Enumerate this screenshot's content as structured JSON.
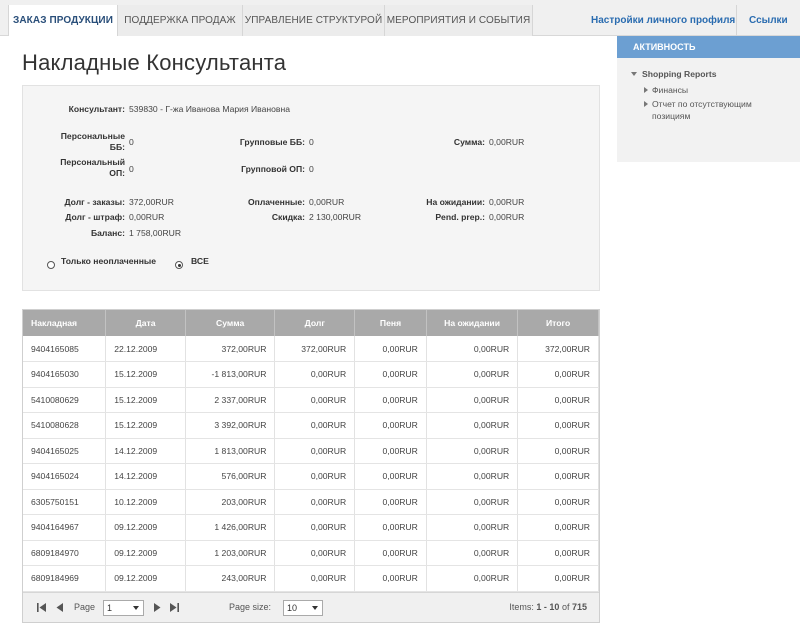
{
  "nav": {
    "tabs": [
      "ЗАКАЗ ПРОДУКЦИИ",
      "ПОДДЕРЖКА ПРОДАЖ",
      "УПРАВЛЕНИЕ СТРУКТУРОЙ",
      "МЕРОПРИЯТИЯ И СОБЫТИЯ"
    ],
    "profile_link": "Настройки личного профиля",
    "links_menu": "Ссылки"
  },
  "page_title": "Накладные Консультанта",
  "summary": {
    "consultant_label": "Консультант:",
    "consultant_value": "539830 - Г-жа Иванова Мария Ивановна",
    "personal_bb_label_1": "Персональные",
    "personal_bb_label_2": "ББ:",
    "personal_bb_value": "0",
    "group_bb_label": "Групповые ББ:",
    "group_bb_value": "0",
    "sum_label": "Сумма:",
    "sum_value": "0,00RUR",
    "personal_op_label_1": "Персональный",
    "personal_op_label_2": "ОП:",
    "personal_op_value": "0",
    "group_op_label": "Групповой ОП:",
    "group_op_value": "0",
    "debt_orders_label": "Долг - заказы:",
    "debt_orders_value": "372,00RUR",
    "paid_label": "Оплаченные:",
    "paid_value": "0,00RUR",
    "pending_label": "На ожидании:",
    "pending_value": "0,00RUR",
    "debt_fine_label": "Долг - штраф:",
    "debt_fine_value": "0,00RUR",
    "discount_label": "Скидка:",
    "discount_value": "2 130,00RUR",
    "pend_prep_label": "Pend. prep.:",
    "pend_prep_value": "0,00RUR",
    "balance_label": "Баланс:",
    "balance_value": "1 758,00RUR",
    "filter_unpaid": "Только неоплаченные",
    "filter_all": "ВСЕ",
    "selected_filter": "all"
  },
  "table": {
    "columns": [
      "Накладная",
      "Дата",
      "Сумма",
      "Долг",
      "Пеня",
      "На ожидании",
      "Итого"
    ],
    "rows": [
      [
        "9404165085",
        "22.12.2009",
        "372,00RUR",
        "372,00RUR",
        "0,00RUR",
        "0,00RUR",
        "372,00RUR"
      ],
      [
        "9404165030",
        "15.12.2009",
        "-1 813,00RUR",
        "0,00RUR",
        "0,00RUR",
        "0,00RUR",
        "0,00RUR"
      ],
      [
        "5410080629",
        "15.12.2009",
        "2 337,00RUR",
        "0,00RUR",
        "0,00RUR",
        "0,00RUR",
        "0,00RUR"
      ],
      [
        "5410080628",
        "15.12.2009",
        "3 392,00RUR",
        "0,00RUR",
        "0,00RUR",
        "0,00RUR",
        "0,00RUR"
      ],
      [
        "9404165025",
        "14.12.2009",
        "1 813,00RUR",
        "0,00RUR",
        "0,00RUR",
        "0,00RUR",
        "0,00RUR"
      ],
      [
        "9404165024",
        "14.12.2009",
        "576,00RUR",
        "0,00RUR",
        "0,00RUR",
        "0,00RUR",
        "0,00RUR"
      ],
      [
        "6305750151",
        "10.12.2009",
        "203,00RUR",
        "0,00RUR",
        "0,00RUR",
        "0,00RUR",
        "0,00RUR"
      ],
      [
        "9404164967",
        "09.12.2009",
        "1 426,00RUR",
        "0,00RUR",
        "0,00RUR",
        "0,00RUR",
        "0,00RUR"
      ],
      [
        "6809184970",
        "09.12.2009",
        "1 203,00RUR",
        "0,00RUR",
        "0,00RUR",
        "0,00RUR",
        "0,00RUR"
      ],
      [
        "6809184969",
        "09.12.2009",
        "243,00RUR",
        "0,00RUR",
        "0,00RUR",
        "0,00RUR",
        "0,00RUR"
      ]
    ]
  },
  "pager": {
    "page_label": "Page",
    "page_value": "1",
    "page_size_label": "Page size:",
    "page_size_value": "10",
    "items_prefix": "Items:",
    "items_range": "1 - 10",
    "items_of": "of",
    "items_total": "715"
  },
  "sidebar": {
    "header": "АКТИВНОСТЬ",
    "section": "Shopping Reports",
    "items": [
      "Финансы",
      "Отчет по отсутствующим",
      "позициям"
    ]
  }
}
